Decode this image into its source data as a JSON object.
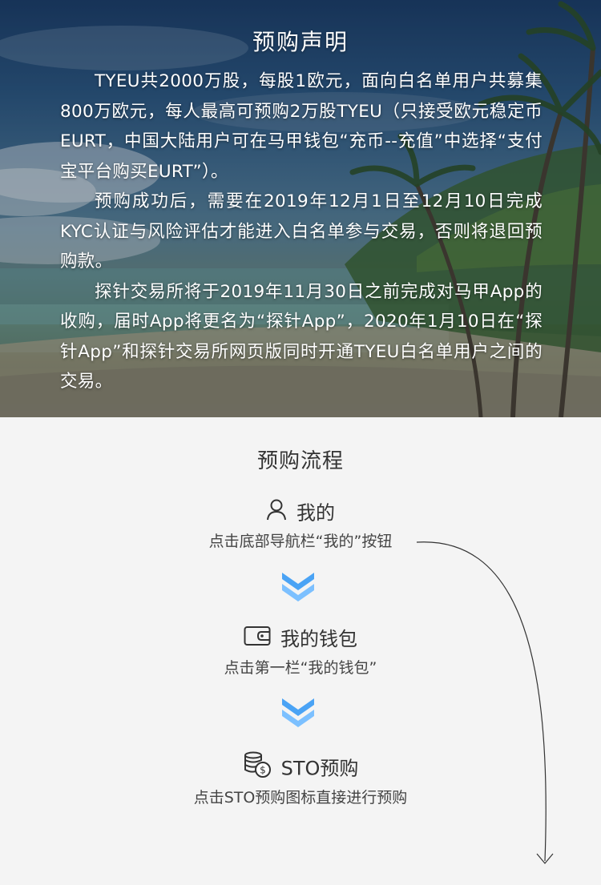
{
  "hero": {
    "title": "预购声明",
    "paragraphs": [
      "TYEU共2000万股，每股1欧元，面向白名单用户共募集800万欧元，每人最高可预购2万股TYEU（只接受欧元稳定币EURT，中国大陆用户可在马甲钱包“充币--充值”中选择“支付宝平台购买EURT”）。",
      "预购成功后，需要在2019年12月1日至12月10日完成KYC认证与风险评估才能进入白名单参与交易，否则将退回预购款。",
      "探针交易所将于2019年11月30日之前完成对马甲App的收购，届时App将更名为“探针App”，2020年1月10日在“探针App”和探针交易所网页版同时开通TYEU白名单用户之间的交易。"
    ]
  },
  "process": {
    "title": "预购流程",
    "steps": [
      {
        "icon": "user-icon",
        "label": "我的",
        "desc": "点击底部导航栏“我的”按钮"
      },
      {
        "icon": "wallet-icon",
        "label": "我的钱包",
        "desc": "点击第一栏“我的钱包”"
      },
      {
        "icon": "coins-icon",
        "label": "STO预购",
        "desc": "点击STO预购图标直接进行预购"
      }
    ]
  },
  "colors": {
    "chevron_top": "#4aa3f5",
    "chevron_bottom": "#7cc0ff",
    "text": "#333333"
  }
}
